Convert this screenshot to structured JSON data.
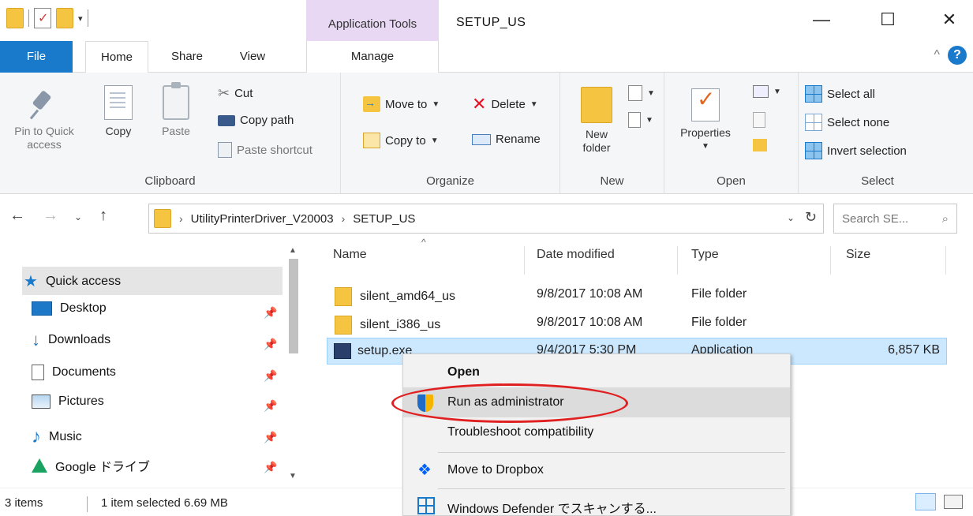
{
  "titlebar": {
    "context_tab": "Application Tools",
    "window_title": "SETUP_US",
    "minimize": "—",
    "maximize": "☐",
    "close": "✕"
  },
  "tabs": {
    "file": "File",
    "home": "Home",
    "share": "Share",
    "view": "View",
    "manage": "Manage"
  },
  "ribbon": {
    "clipboard": {
      "label": "Clipboard",
      "pin": "Pin to Quick\naccess",
      "copy": "Copy",
      "paste": "Paste",
      "cut": "Cut",
      "copy_path": "Copy path",
      "paste_shortcut": "Paste shortcut"
    },
    "organize": {
      "label": "Organize",
      "move_to": "Move to",
      "delete": "Delete",
      "copy_to": "Copy to",
      "rename": "Rename"
    },
    "new": {
      "label": "New",
      "new_folder": "New\nfolder"
    },
    "open": {
      "label": "Open",
      "properties": "Properties"
    },
    "select": {
      "label": "Select",
      "select_all": "Select all",
      "select_none": "Select none",
      "invert_selection": "Invert selection"
    }
  },
  "address": {
    "crumbs": [
      "UtilityPrinterDriver_V20003",
      "SETUP_US"
    ],
    "search_placeholder": "Search SE..."
  },
  "nav": {
    "quick_access": "Quick access",
    "items": [
      {
        "label": "Desktop",
        "icon": "desktop-icon",
        "pinned": true
      },
      {
        "label": "Downloads",
        "icon": "downloads-icon",
        "pinned": true
      },
      {
        "label": "Documents",
        "icon": "documents-icon",
        "pinned": true
      },
      {
        "label": "Pictures",
        "icon": "pictures-icon",
        "pinned": true
      },
      {
        "label": "Music",
        "icon": "music-icon",
        "pinned": true
      },
      {
        "label": "Google ドライブ",
        "icon": "google-drive-icon",
        "pinned": true
      }
    ]
  },
  "files": {
    "columns": [
      "Name",
      "Date modified",
      "Type",
      "Size"
    ],
    "rows": [
      {
        "name": "silent_amd64_us",
        "date": "9/8/2017 10:08 AM",
        "type": "File folder",
        "size": "",
        "icon": "folder-icon",
        "selected": false
      },
      {
        "name": "silent_i386_us",
        "date": "9/8/2017 10:08 AM",
        "type": "File folder",
        "size": "",
        "icon": "folder-icon",
        "selected": false
      },
      {
        "name": "setup.exe",
        "date": "9/4/2017 5:30 PM",
        "type": "Application",
        "size": "6,857 KB",
        "icon": "exe-icon",
        "selected": true
      }
    ]
  },
  "status": {
    "count": "3 items",
    "selection": "1 item selected  6.69 MB"
  },
  "context_menu": {
    "items": [
      {
        "label": "Open",
        "icon": "",
        "bold": true
      },
      {
        "label": "Run as administrator",
        "icon": "shield-icon",
        "highlighted": true
      },
      {
        "label": "Troubleshoot compatibility",
        "icon": ""
      },
      {
        "label": "Move to Dropbox",
        "icon": "dropbox-icon"
      },
      {
        "label": "Windows Defender でスキャンする...",
        "icon": "defender-icon"
      }
    ]
  },
  "colors": {
    "accent": "#1979ca",
    "context_tab_bg": "#e8d8f4",
    "selection_bg": "#cce8ff",
    "annotation": "#e02020"
  }
}
